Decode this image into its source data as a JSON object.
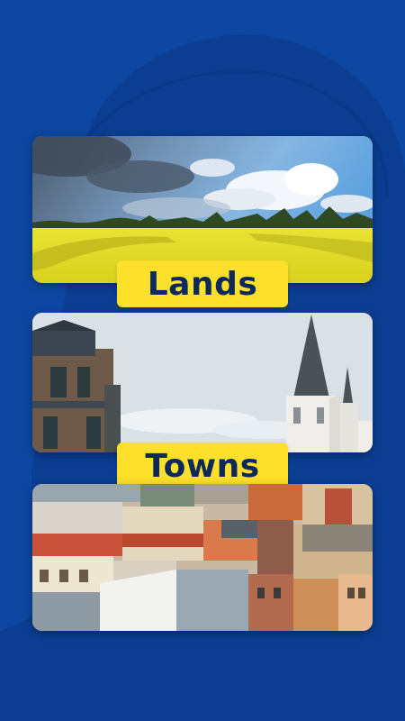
{
  "categories": {
    "lands_label": "Lands",
    "towns_label": "Towns"
  },
  "colors": {
    "background": "#0d47a1",
    "accent_yellow": "#fde02b",
    "label_text": "#0b2a5b"
  }
}
